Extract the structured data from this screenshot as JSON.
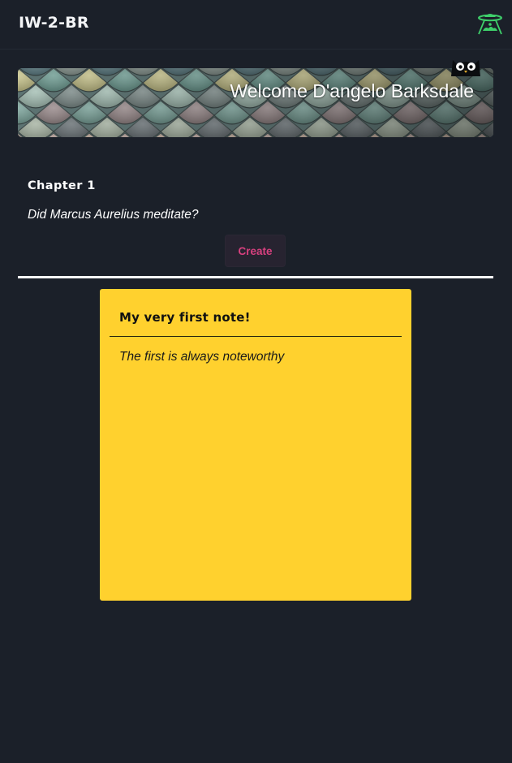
{
  "header": {
    "brand": "IW-2-BR",
    "logo_icon": "ufo-abduction-icon",
    "logo_color": "#3ecf6a"
  },
  "banner": {
    "welcome_text": "Welcome D'angelo Barksdale",
    "background": "colorful-slate-tiles",
    "mascot_icon": "owl-icon"
  },
  "prompt": {
    "chapter": "Chapter 1",
    "question": "Did Marcus Aurelius meditate?",
    "create_label": "Create",
    "create_color": "#d8407f"
  },
  "notes": [
    {
      "title": "My very first note!",
      "body": "The first is always noteworthy",
      "color": "#ffd12e"
    }
  ],
  "theme": {
    "background": "#1b2029",
    "divider": "#ffffff"
  }
}
